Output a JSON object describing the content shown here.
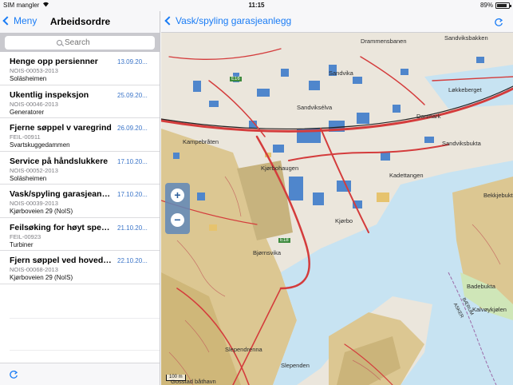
{
  "status_bar": {
    "carrier": "SIM mangler",
    "time": "11:15",
    "battery": "89%",
    "battery_level": 0.89
  },
  "left_nav": {
    "back_label": "Meny",
    "title": "Arbeidsordre"
  },
  "search": {
    "placeholder": "Search"
  },
  "work_orders": [
    {
      "title": "Henge opp persienner",
      "date": "13.09.20...",
      "code": "NOIS-00053-2013",
      "place": "Soläsheimen"
    },
    {
      "title": "Ukentlig inspeksjon",
      "date": "25.09.20...",
      "code": "NOIS-00046-2013",
      "place": "Generatorer"
    },
    {
      "title": "Fjerne søppel v varegrind",
      "date": "26.09.20...",
      "code": "FEIL-00911",
      "place": "Svartskuggedammen"
    },
    {
      "title": "Service på håndslukkere",
      "date": "17.10.20...",
      "code": "NOIS-00052-2013",
      "place": "Soläsheimen"
    },
    {
      "title": "Vask/spyling garasjeanlegg",
      "date": "17.10.20...",
      "code": "NOIS-00039-2013",
      "place": "Kjørboveien 29 (NoIS)"
    },
    {
      "title": "Feilsøking for høyt spenn...",
      "date": "21.10.20...",
      "code": "FEIL-00923",
      "place": "Turbiner"
    },
    {
      "title": "Fjern søppel ved hovedin...",
      "date": "22.10.20...",
      "code": "NOIS-00068-2013",
      "place": "Kjørboveien 29 (NoIS)"
    }
  ],
  "detail_nav": {
    "title": "Vask/spyling garasjeanlegg"
  },
  "map": {
    "zoom_in": "+",
    "zoom_out": "−",
    "scale": "100 m",
    "labels": [
      {
        "text": "Drammensbanen",
        "name": "map-label-drammensbanen"
      },
      {
        "text": "Sandviksbakken",
        "name": "map-label-sandviksbakken"
      },
      {
        "text": "Sandvika",
        "name": "map-label-sandvika"
      },
      {
        "text": "Løkkeberget",
        "name": "map-label-lokkeberget"
      },
      {
        "text": "Sandviksélva",
        "name": "map-label-sandvikselva"
      },
      {
        "text": "Danmark",
        "name": "map-label-danmark"
      },
      {
        "text": "Kampebråten",
        "name": "map-label-kampebraten"
      },
      {
        "text": "Sandviksbukta",
        "name": "map-label-sandviksbukta"
      },
      {
        "text": "Kjørbohaugen",
        "name": "map-label-kjorbohaugen"
      },
      {
        "text": "Kadettangen",
        "name": "map-label-kadettangen"
      },
      {
        "text": "Bekkjebukta",
        "name": "map-label-bekkjebukta"
      },
      {
        "text": "Kjørbo",
        "name": "map-label-kjorbo"
      },
      {
        "text": "Bjørnsvika",
        "name": "map-label-bjornsvika"
      },
      {
        "text": "Badebukta",
        "name": "map-label-badebukta"
      },
      {
        "text": "Kalvøykjølen",
        "name": "map-label-kalvoykjolen"
      },
      {
        "text": "Slependrenna",
        "name": "map-label-slependrenna"
      },
      {
        "text": "Slependen",
        "name": "map-label-slependen"
      },
      {
        "text": "Gosstad båthavn",
        "name": "map-label-gosstad"
      },
      {
        "text": "BÆRUM",
        "name": "map-label-baerum"
      },
      {
        "text": "ASKER",
        "name": "map-label-asker"
      },
      {
        "text": "E16",
        "name": "map-label-e16"
      },
      {
        "text": "E18",
        "name": "map-label-e18"
      }
    ]
  },
  "colors": {
    "accent": "#1a7cf5",
    "date": "#3a74c8",
    "water": "#c7e3f2",
    "road": "#d43c3c",
    "building": "#4f86cc",
    "forest": "#d7c28f"
  }
}
